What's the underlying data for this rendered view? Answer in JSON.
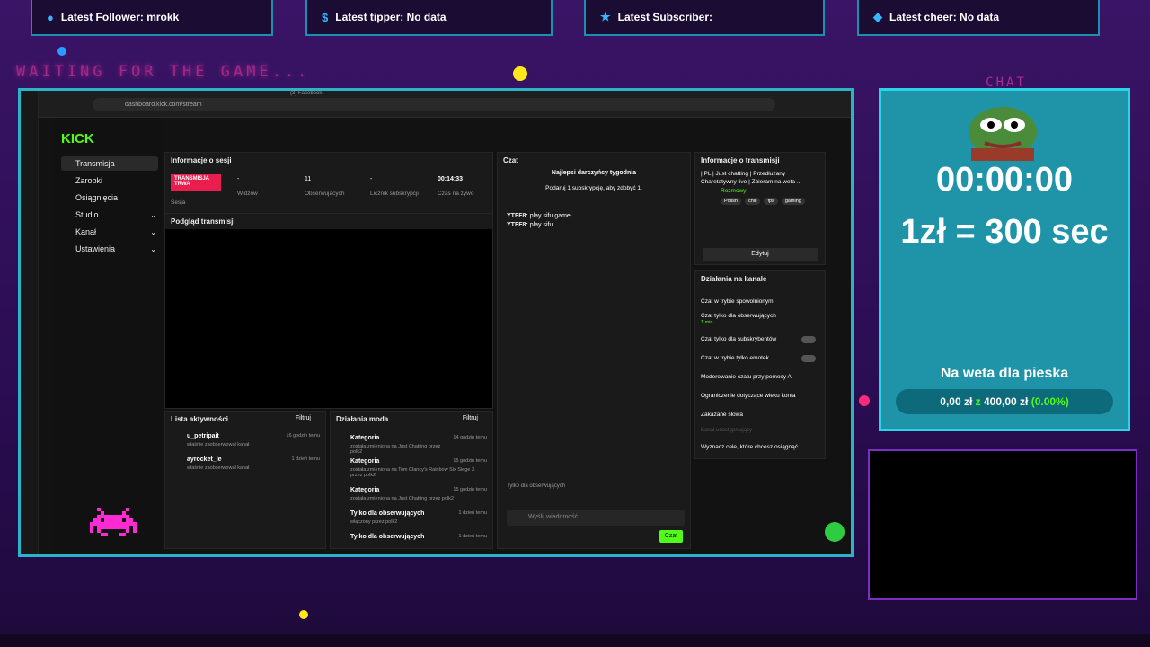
{
  "top_bars": [
    {
      "label": "Latest Follower: mrokk_",
      "icon": "user-icon"
    },
    {
      "label": "Latest tipper: No data",
      "icon": "dollar-icon"
    },
    {
      "label": "Latest Subscriber:",
      "icon": "star-icon"
    },
    {
      "label": "Latest cheer: No data",
      "icon": "diamond-icon"
    }
  ],
  "waiting_text": "WAITING FOR THE GAME...",
  "browser": {
    "url": "dashboard.kick.com/stream",
    "tab": "(3) Facebook"
  },
  "kick": {
    "logo": "KICK",
    "nav": [
      {
        "label": "Transmisja",
        "active": true
      },
      {
        "label": "Zarobki"
      },
      {
        "label": "Osiągnięcia"
      },
      {
        "label": "Studio",
        "chevron": true
      },
      {
        "label": "Kanał",
        "chevron": true
      },
      {
        "label": "Ustawienia",
        "chevron": true
      }
    ],
    "session": {
      "title": "Informacje o sesji",
      "live_badge": "TRANSMISJA TRWA",
      "session_label": "Sesja",
      "viewers_value": "-",
      "viewers_label": "Widzów",
      "followers_value": "11",
      "followers_label": "Obserwujących",
      "subs_value": "-",
      "subs_label": "Licznik subskrypcji",
      "time_value": "00:14:33",
      "time_label": "Czas na żywo"
    },
    "preview_title": "Podgląd transmisji",
    "activity": {
      "title": "Lista aktywności",
      "filter": "Filtruj",
      "items": [
        {
          "user": "u_petripait",
          "desc": "właśnie zaobserwował kanał",
          "time": "16 godzin temu"
        },
        {
          "user": "ayrocket_le",
          "desc": "właśnie zaobserwował kanał",
          "time": "1 dzień temu"
        }
      ]
    },
    "mod": {
      "title": "Działania moda",
      "filter": "Filtruj",
      "items": [
        {
          "title": "Kategoria",
          "desc": "została zmieniona na Just Chatting przez polk2",
          "time": "14 godzin temu"
        },
        {
          "title": "Kategoria",
          "desc": "została zmieniona na Tom Clancy's Rainbow Six Siege X przez polk2",
          "time": "15 godzin temu"
        },
        {
          "title": "Kategoria",
          "desc": "została zmieniona na Just Chatting przez polk2",
          "time": "15 godzin temu"
        },
        {
          "title": "Tylko dla obserwujących",
          "desc": "włączony przez polk2",
          "time": "1 dzień temu"
        },
        {
          "title": "Tylko dla obserwujących",
          "desc": "",
          "time": "1 dzień temu"
        }
      ]
    },
    "chat": {
      "title": "Czat",
      "top_gifters": "Najlepsi darczyńcy tygodnia",
      "gift_prompt": "Podaruj 1 subskrypcję, aby zdobyć 1.",
      "messages": [
        {
          "user": "YTFF8:",
          "text": "play sifu game"
        },
        {
          "user": "YTFF8:",
          "text": "play sifu"
        }
      ],
      "followers_only": "Tylko dla obserwujących",
      "placeholder": "Wyślij wiadomość",
      "send": "Czat"
    },
    "stream_info": {
      "title": "Informacje o transmisji",
      "stream_title": "| PL | Just chatting | Przedłużany Charetatywny live | Zbieram na weta ...",
      "category": "Rozmowy",
      "tags": [
        "Polish",
        "chill",
        "fps",
        "gaming"
      ],
      "edit": "Edytuj"
    },
    "channel_actions": {
      "title": "Działania na kanale",
      "items": [
        {
          "label": "Czat w trybie spowolnionym"
        },
        {
          "label": "Czat tylko dla obserwujących",
          "sub": "1 min"
        },
        {
          "label": "Czat tylko dla subskrybentów",
          "toggle": true
        },
        {
          "label": "Czat w trybie tylko emotek",
          "toggle": true
        },
        {
          "label": "Moderowanie czatu przy pomocy AI"
        },
        {
          "label": "Ograniczenie dotyczące wieku konta"
        },
        {
          "label": "Zakazane słowa"
        },
        {
          "label": "Kanał udostępniający"
        },
        {
          "label": "Wyznacz cele, które chcesz osiągnąć"
        }
      ]
    }
  },
  "overlay": {
    "chat_label": "CHAT",
    "timer": "00:00:00",
    "rate": "1zł = 300 sec",
    "goal_title": "Na weta dla pieska",
    "goal_current": "0,00 zł",
    "goal_sep": "z",
    "goal_target": "400,00 zł",
    "goal_pct": "(0.00%)",
    "goal_fraction": 0.0
  },
  "colors": {
    "accent": "#53fc18",
    "frame": "#2bb3c9",
    "live": "#e91e4f",
    "overlay_bg": "#1f93a8"
  }
}
